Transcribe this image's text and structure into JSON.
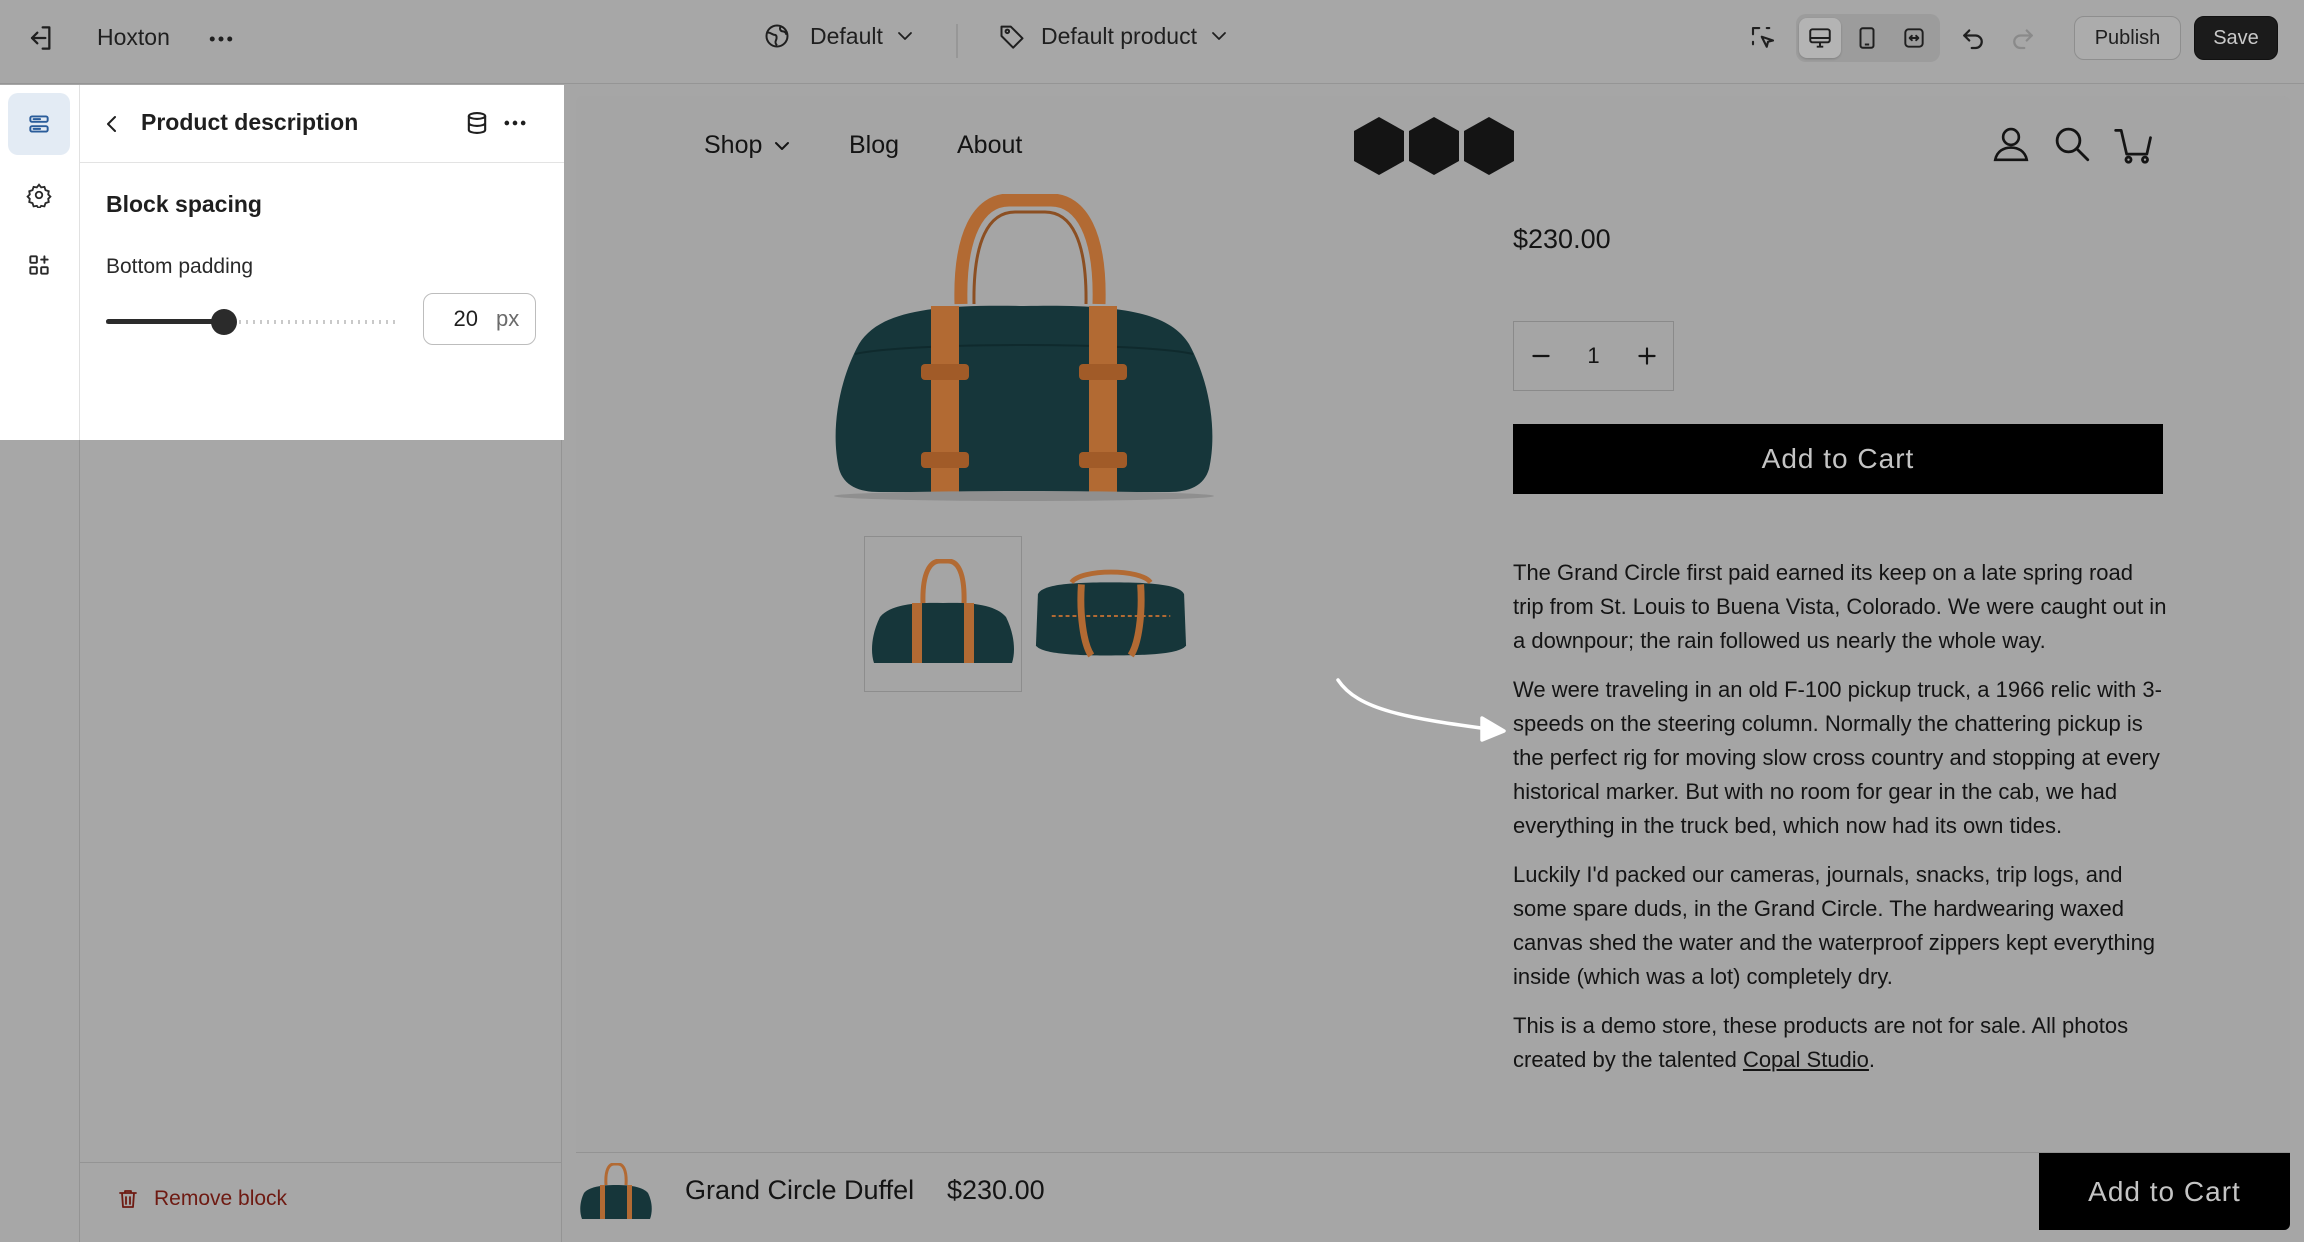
{
  "topbar": {
    "store_name": "Hoxton",
    "theme_selector": "Default",
    "template_selector": "Default product",
    "publish_label": "Publish",
    "save_label": "Save"
  },
  "panel": {
    "title": "Product description",
    "section_title": "Block spacing",
    "field_label": "Bottom padding",
    "slider_value": 20,
    "slider_fraction": 0.4,
    "unit": "px",
    "remove_label": "Remove block"
  },
  "preview": {
    "nav": [
      "Shop",
      "Blog",
      "About"
    ],
    "price": "$230.00",
    "quantity": "1",
    "add_to_cart": "Add to Cart",
    "description": {
      "p1": "The Grand Circle first paid earned its keep on a late spring road trip from St. Louis to Buena Vista, Colorado. We were caught out in a downpour; the rain followed us nearly the whole way.",
      "p2": "We were traveling in an old F-100 pickup truck, a 1966 relic with 3-speeds on the steering column. Normally the chattering pickup is the perfect rig for moving slow cross country and stopping at every historical marker. But with no room for gear in the cab, we had everything in the truck bed, which now had its own tides.",
      "p3": "Luckily I'd packed our cameras, journals, snacks, trip logs, and some spare duds, in the Grand Circle. The hardwearing waxed canvas shed the water and the waterproof zippers kept everything inside (which was a lot) completely dry.",
      "p4_start": "This is a demo store, these products are not for sale. All photos created by the talented ",
      "p4_link": "Copal Studio",
      "p4_end": "."
    },
    "sticky": {
      "product_name": "Grand Circle Duffel",
      "price": "$230.00",
      "add_to_cart": "Add to Cart"
    }
  },
  "colors": {
    "overlay_gray": "#a6a6a6",
    "button_black": "#000000",
    "danger_text": "#6e1a12",
    "bag_canvas": "#16363a",
    "bag_leather": "#b26a33"
  },
  "icons": [
    "exit-icon",
    "more-icon",
    "globe-icon",
    "tag-icon",
    "chevron-down-icon",
    "select-icon",
    "desktop-icon",
    "mobile-icon",
    "fullwidth-icon",
    "undo-icon",
    "redo-icon",
    "sections-icon",
    "gear-icon",
    "apps-icon",
    "back-icon",
    "database-icon",
    "trash-icon",
    "account-icon",
    "search-icon",
    "cart-icon",
    "minus-icon",
    "plus-icon",
    "arrow-icon"
  ]
}
